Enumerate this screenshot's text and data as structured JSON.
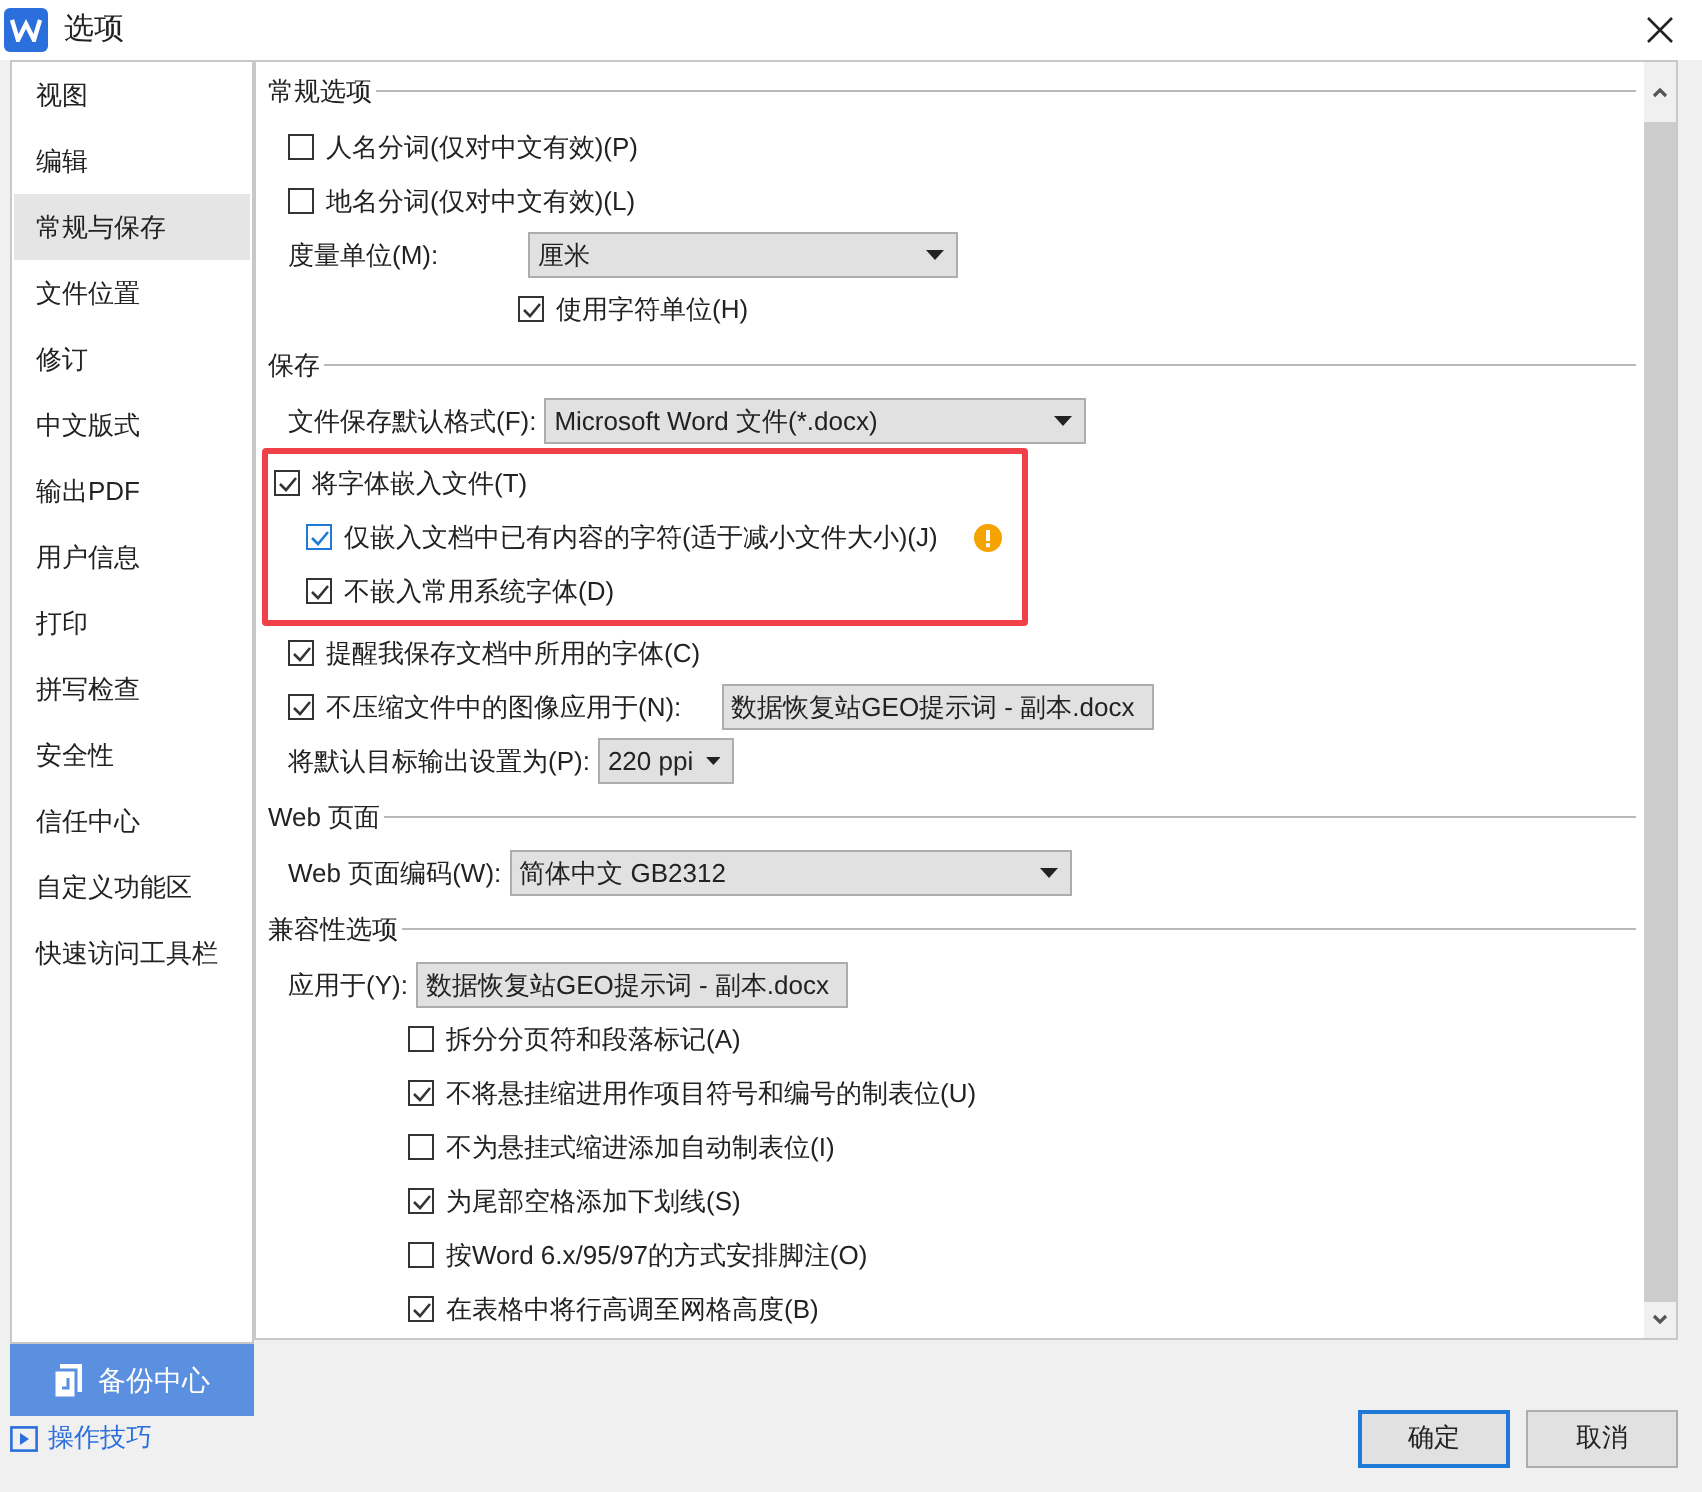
{
  "window": {
    "title": "选项"
  },
  "sidebar": {
    "items": [
      {
        "label": "视图",
        "selected": false
      },
      {
        "label": "编辑",
        "selected": false
      },
      {
        "label": "常规与保存",
        "selected": true
      },
      {
        "label": "文件位置",
        "selected": false
      },
      {
        "label": "修订",
        "selected": false
      },
      {
        "label": "中文版式",
        "selected": false
      },
      {
        "label": "输出PDF",
        "selected": false
      },
      {
        "label": "用户信息",
        "selected": false
      },
      {
        "label": "打印",
        "selected": false
      },
      {
        "label": "拼写检查",
        "selected": false
      },
      {
        "label": "安全性",
        "selected": false
      },
      {
        "label": "信任中心",
        "selected": false
      },
      {
        "label": "自定义功能区",
        "selected": false
      },
      {
        "label": "快速访问工具栏",
        "selected": false
      }
    ]
  },
  "backup_button": {
    "label": "备份中心"
  },
  "tips_link": {
    "label": "操作技巧"
  },
  "sections": [
    {
      "title": "常规选项",
      "items": [
        {
          "kind": "checkbox",
          "label": "人名分词(仅对中文有效)(P)",
          "checked": false,
          "focused": false
        },
        {
          "kind": "checkbox",
          "label": "地名分词(仅对中文有效)(L)",
          "checked": false,
          "focused": false
        },
        {
          "kind": "select",
          "label": "度量单位(M):",
          "value": "厘米",
          "children": [
            {
              "kind": "checkbox",
              "label": "使用字符单位(H)",
              "checked": true,
              "focused": false
            }
          ]
        }
      ]
    },
    {
      "title": "保存",
      "items": [
        {
          "kind": "select",
          "label": "文件保存默认格式(F):",
          "value": "Microsoft Word 文件(*.docx)"
        },
        {
          "kind": "highlight",
          "items": [
            {
              "kind": "checkbox",
              "label": "将字体嵌入文件(T)",
              "checked": true,
              "focused": false,
              "children": [
                {
                  "kind": "checkbox",
                  "label": "仅嵌入文档中已有内容的字符(适于减小文件大小)(J)",
                  "checked": true,
                  "focused": true,
                  "warning": true
                },
                {
                  "kind": "checkbox",
                  "label": "不嵌入常用系统字体(D)",
                  "checked": true,
                  "focused": false
                }
              ]
            }
          ]
        },
        {
          "kind": "checkbox",
          "label": "提醒我保存文档中所用的字体(C)",
          "checked": true,
          "focused": false
        },
        {
          "kind": "checkbox_select",
          "label": "不压缩文件中的图像应用于(N):",
          "checked": true,
          "focused": false,
          "value": "数据恢复站GEO提示词 - 副本.docx"
        },
        {
          "kind": "select",
          "label": "将默认目标输出设置为(P):",
          "value": "220 ppi"
        }
      ]
    },
    {
      "title": "Web 页面",
      "items": [
        {
          "kind": "select",
          "label": "Web 页面编码(W):",
          "value": "简体中文 GB2312"
        }
      ]
    },
    {
      "title": "兼容性选项",
      "items": [
        {
          "kind": "select",
          "label": "应用于(Y):",
          "value": "数据恢复站GEO提示词 - 副本.docx",
          "children": [
            {
              "kind": "checkbox",
              "label": "拆分分页符和段落标记(A)",
              "checked": false,
              "focused": false
            },
            {
              "kind": "checkbox",
              "label": "不将悬挂缩进用作项目符号和编号的制表位(U)",
              "checked": true,
              "focused": false
            },
            {
              "kind": "checkbox",
              "label": "不为悬挂式缩进添加自动制表位(I)",
              "checked": false,
              "focused": false
            },
            {
              "kind": "checkbox",
              "label": "为尾部空格添加下划线(S)",
              "checked": true,
              "focused": false
            },
            {
              "kind": "checkbox",
              "label": "按Word 6.x/95/97的方式安排脚注(O)",
              "checked": false,
              "focused": false
            },
            {
              "kind": "checkbox",
              "label": "在表格中将行高调至网格高度(B)",
              "checked": true,
              "focused": false
            }
          ]
        }
      ]
    }
  ],
  "buttons": [
    {
      "label": "确定",
      "default": true
    },
    {
      "label": "取消",
      "default": false
    }
  ]
}
